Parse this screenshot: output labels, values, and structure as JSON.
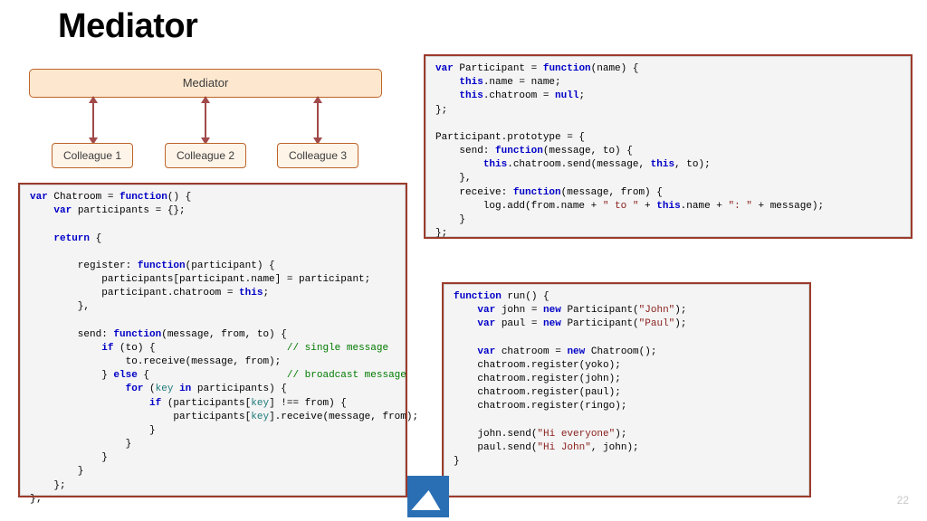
{
  "title": "Mediator",
  "page_number": "22",
  "diagram": {
    "mediator": "Mediator",
    "c1": "Colleague 1",
    "c2": "Colleague 2",
    "c3": "Colleague 3"
  },
  "code_left_html": "<span class=\"kw\">var</span> Chatroom = <span class=\"kw\">function</span>() {\n    <span class=\"kw\">var</span> participants = {};\n\n    <span class=\"kw\">return</span> {\n\n        register: <span class=\"kw\">function</span>(participant) {\n            participants[participant.name] = participant;\n            participant.chatroom = <span class=\"kw\">this</span>;\n        },\n\n        send: <span class=\"kw\">function</span>(message, from, to) {\n            <span class=\"kw\">if</span> (to) {                      <span class=\"cmt\">// single message</span>\n                to.receive(message, from);\n            } <span class=\"kw\">else</span> {                       <span class=\"cmt\">// broadcast message</span>\n                <span class=\"kw\">for</span> (<span class=\"teal\">key</span> <span class=\"kw\">in</span> participants) {\n                    <span class=\"kw\">if</span> (participants[<span class=\"teal\">key</span>] !== from) {\n                        participants[<span class=\"teal\">key</span>].receive(message, from);\n                    }\n                }\n            }\n        }\n    };\n};",
  "code_tr_html": "<span class=\"kw\">var</span> Participant = <span class=\"kw\">function</span>(name) {\n    <span class=\"kw\">this</span>.name = name;\n    <span class=\"kw\">this</span>.chatroom = <span class=\"kw\">null</span>;\n};\n\nParticipant.prototype = {\n    send: <span class=\"kw\">function</span>(message, to) {\n        <span class=\"kw\">this</span>.chatroom.send(message, <span class=\"kw\">this</span>, to);\n    },\n    receive: <span class=\"kw\">function</span>(message, from) {\n        log.add(from.name + <span class=\"str\">\" to \"</span> + <span class=\"kw\">this</span>.name + <span class=\"str\">\": \"</span> + message);\n    }\n};",
  "code_br_html": "<span class=\"kw\">function</span> run() {\n    <span class=\"kw\">var</span> john = <span class=\"kw\">new</span> Participant(<span class=\"str\">\"John\"</span>);\n    <span class=\"kw\">var</span> paul = <span class=\"kw\">new</span> Participant(<span class=\"str\">\"Paul\"</span>);\n\n    <span class=\"kw\">var</span> chatroom = <span class=\"kw\">new</span> Chatroom();\n    chatroom.register(yoko);\n    chatroom.register(john);\n    chatroom.register(paul);\n    chatroom.register(ringo);\n\n    john.send(<span class=\"str\">\"Hi everyone\"</span>);\n    paul.send(<span class=\"str\">\"Hi John\"</span>, john);\n}"
}
